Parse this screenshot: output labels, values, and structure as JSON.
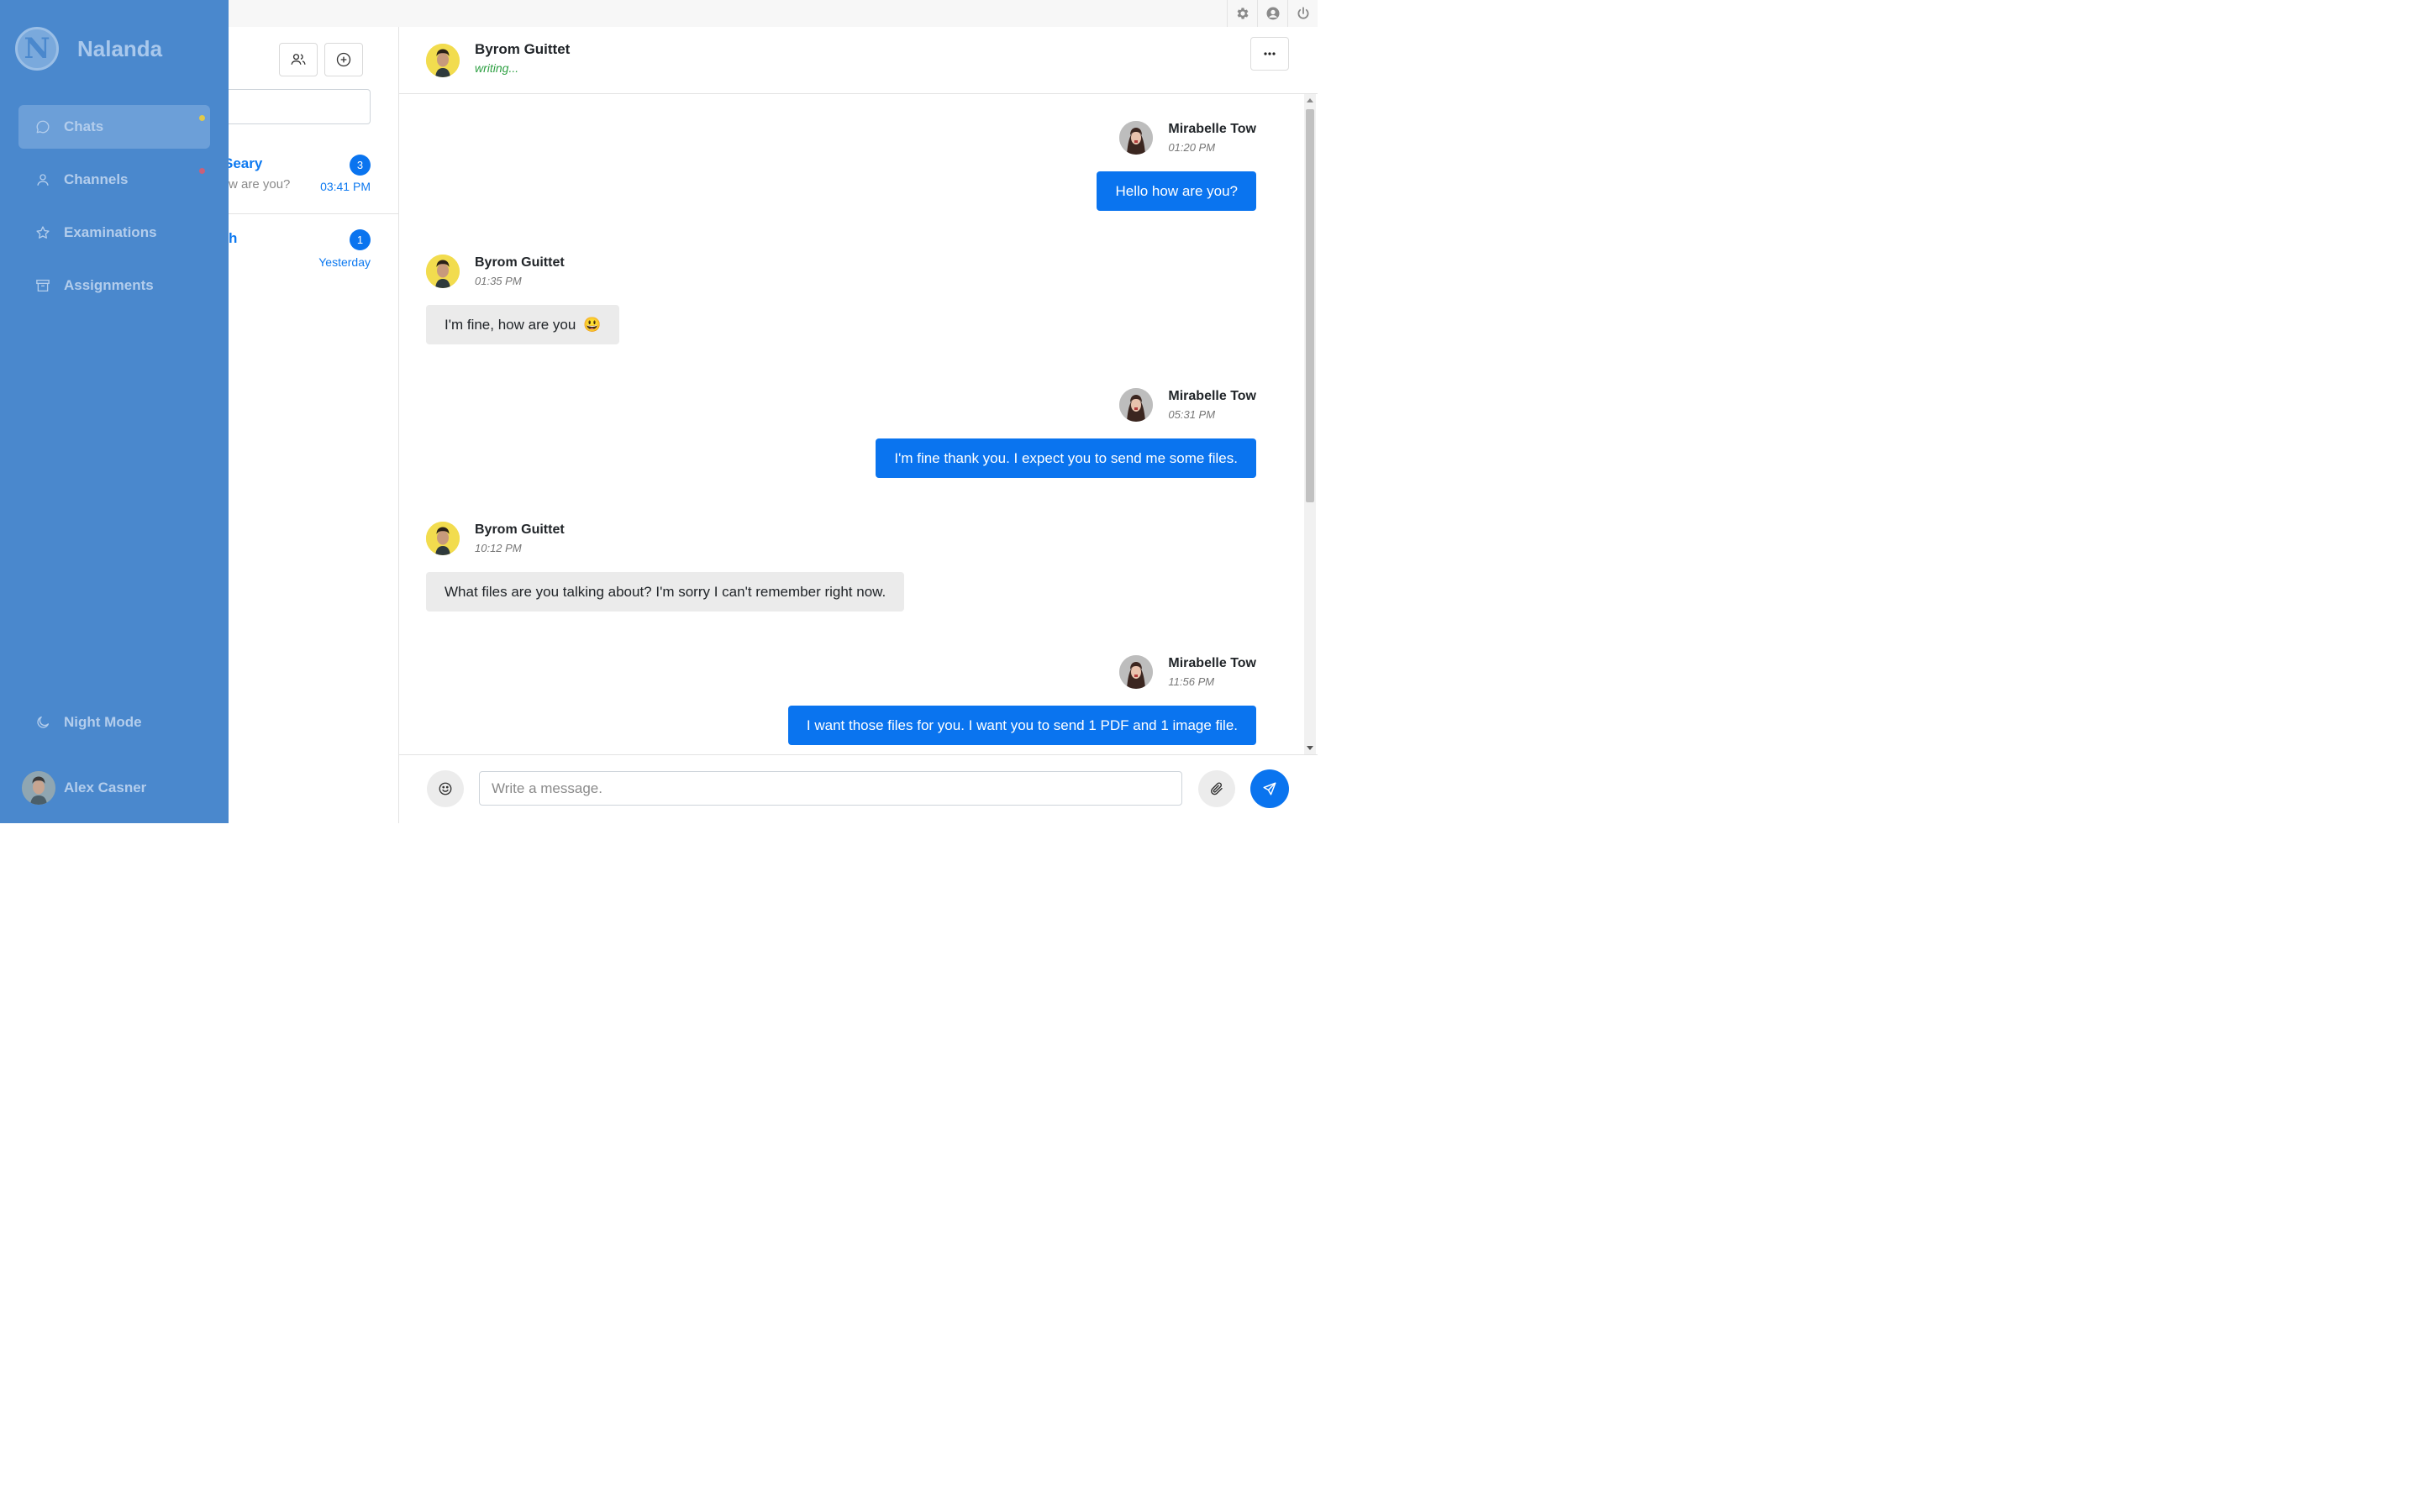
{
  "app": {
    "name": "Nalanda",
    "logo_letter": "N"
  },
  "topbar": {
    "icons": [
      "gear-icon",
      "user-circle-icon",
      "power-icon"
    ]
  },
  "sidebar": {
    "items": [
      {
        "label": "Chats",
        "icon": "chat-bubble-icon",
        "active": true,
        "dot_color": "#e0c94a"
      },
      {
        "label": "Channels",
        "icon": "person-icon",
        "active": false,
        "dot_color": "#c9607a"
      },
      {
        "label": "Examinations",
        "icon": "star-icon",
        "active": false
      },
      {
        "label": "Assignments",
        "icon": "archive-icon",
        "active": false
      }
    ],
    "night_mode": "Night Mode",
    "user_name": "Alex Casner"
  },
  "chat_list": {
    "items": [
      {
        "name": "Seary",
        "preview": "w are you?",
        "badge": "3",
        "time": "03:41 PM"
      },
      {
        "name": "h",
        "preview": "",
        "badge": "1",
        "time": "Yesterday"
      }
    ]
  },
  "chat_header": {
    "name": "Byrom Guittet",
    "status": "writing..."
  },
  "messages": [
    {
      "sender": "Mirabelle Tow",
      "time": "01:20 PM",
      "text": "Hello how are you?",
      "direction": "out"
    },
    {
      "sender": "Byrom Guittet",
      "time": "01:35 PM",
      "text": "I'm fine, how are you",
      "emoji": "😃",
      "direction": "in"
    },
    {
      "sender": "Mirabelle Tow",
      "time": "05:31 PM",
      "text": "I'm fine thank you. I expect you to send me some files.",
      "direction": "out"
    },
    {
      "sender": "Byrom Guittet",
      "time": "10:12 PM",
      "text": "What files are you talking about? I'm sorry I can't remember right now.",
      "direction": "in"
    },
    {
      "sender": "Mirabelle Tow",
      "time": "11:56 PM",
      "text": "I want those files for you. I want you to send 1 PDF and 1 image file.",
      "direction": "out"
    }
  ],
  "composer": {
    "placeholder": "Write a message.",
    "value": ""
  },
  "colors": {
    "sidebar": "#4a88cd",
    "accent": "#0a74ef",
    "writing": "#2ea043"
  }
}
